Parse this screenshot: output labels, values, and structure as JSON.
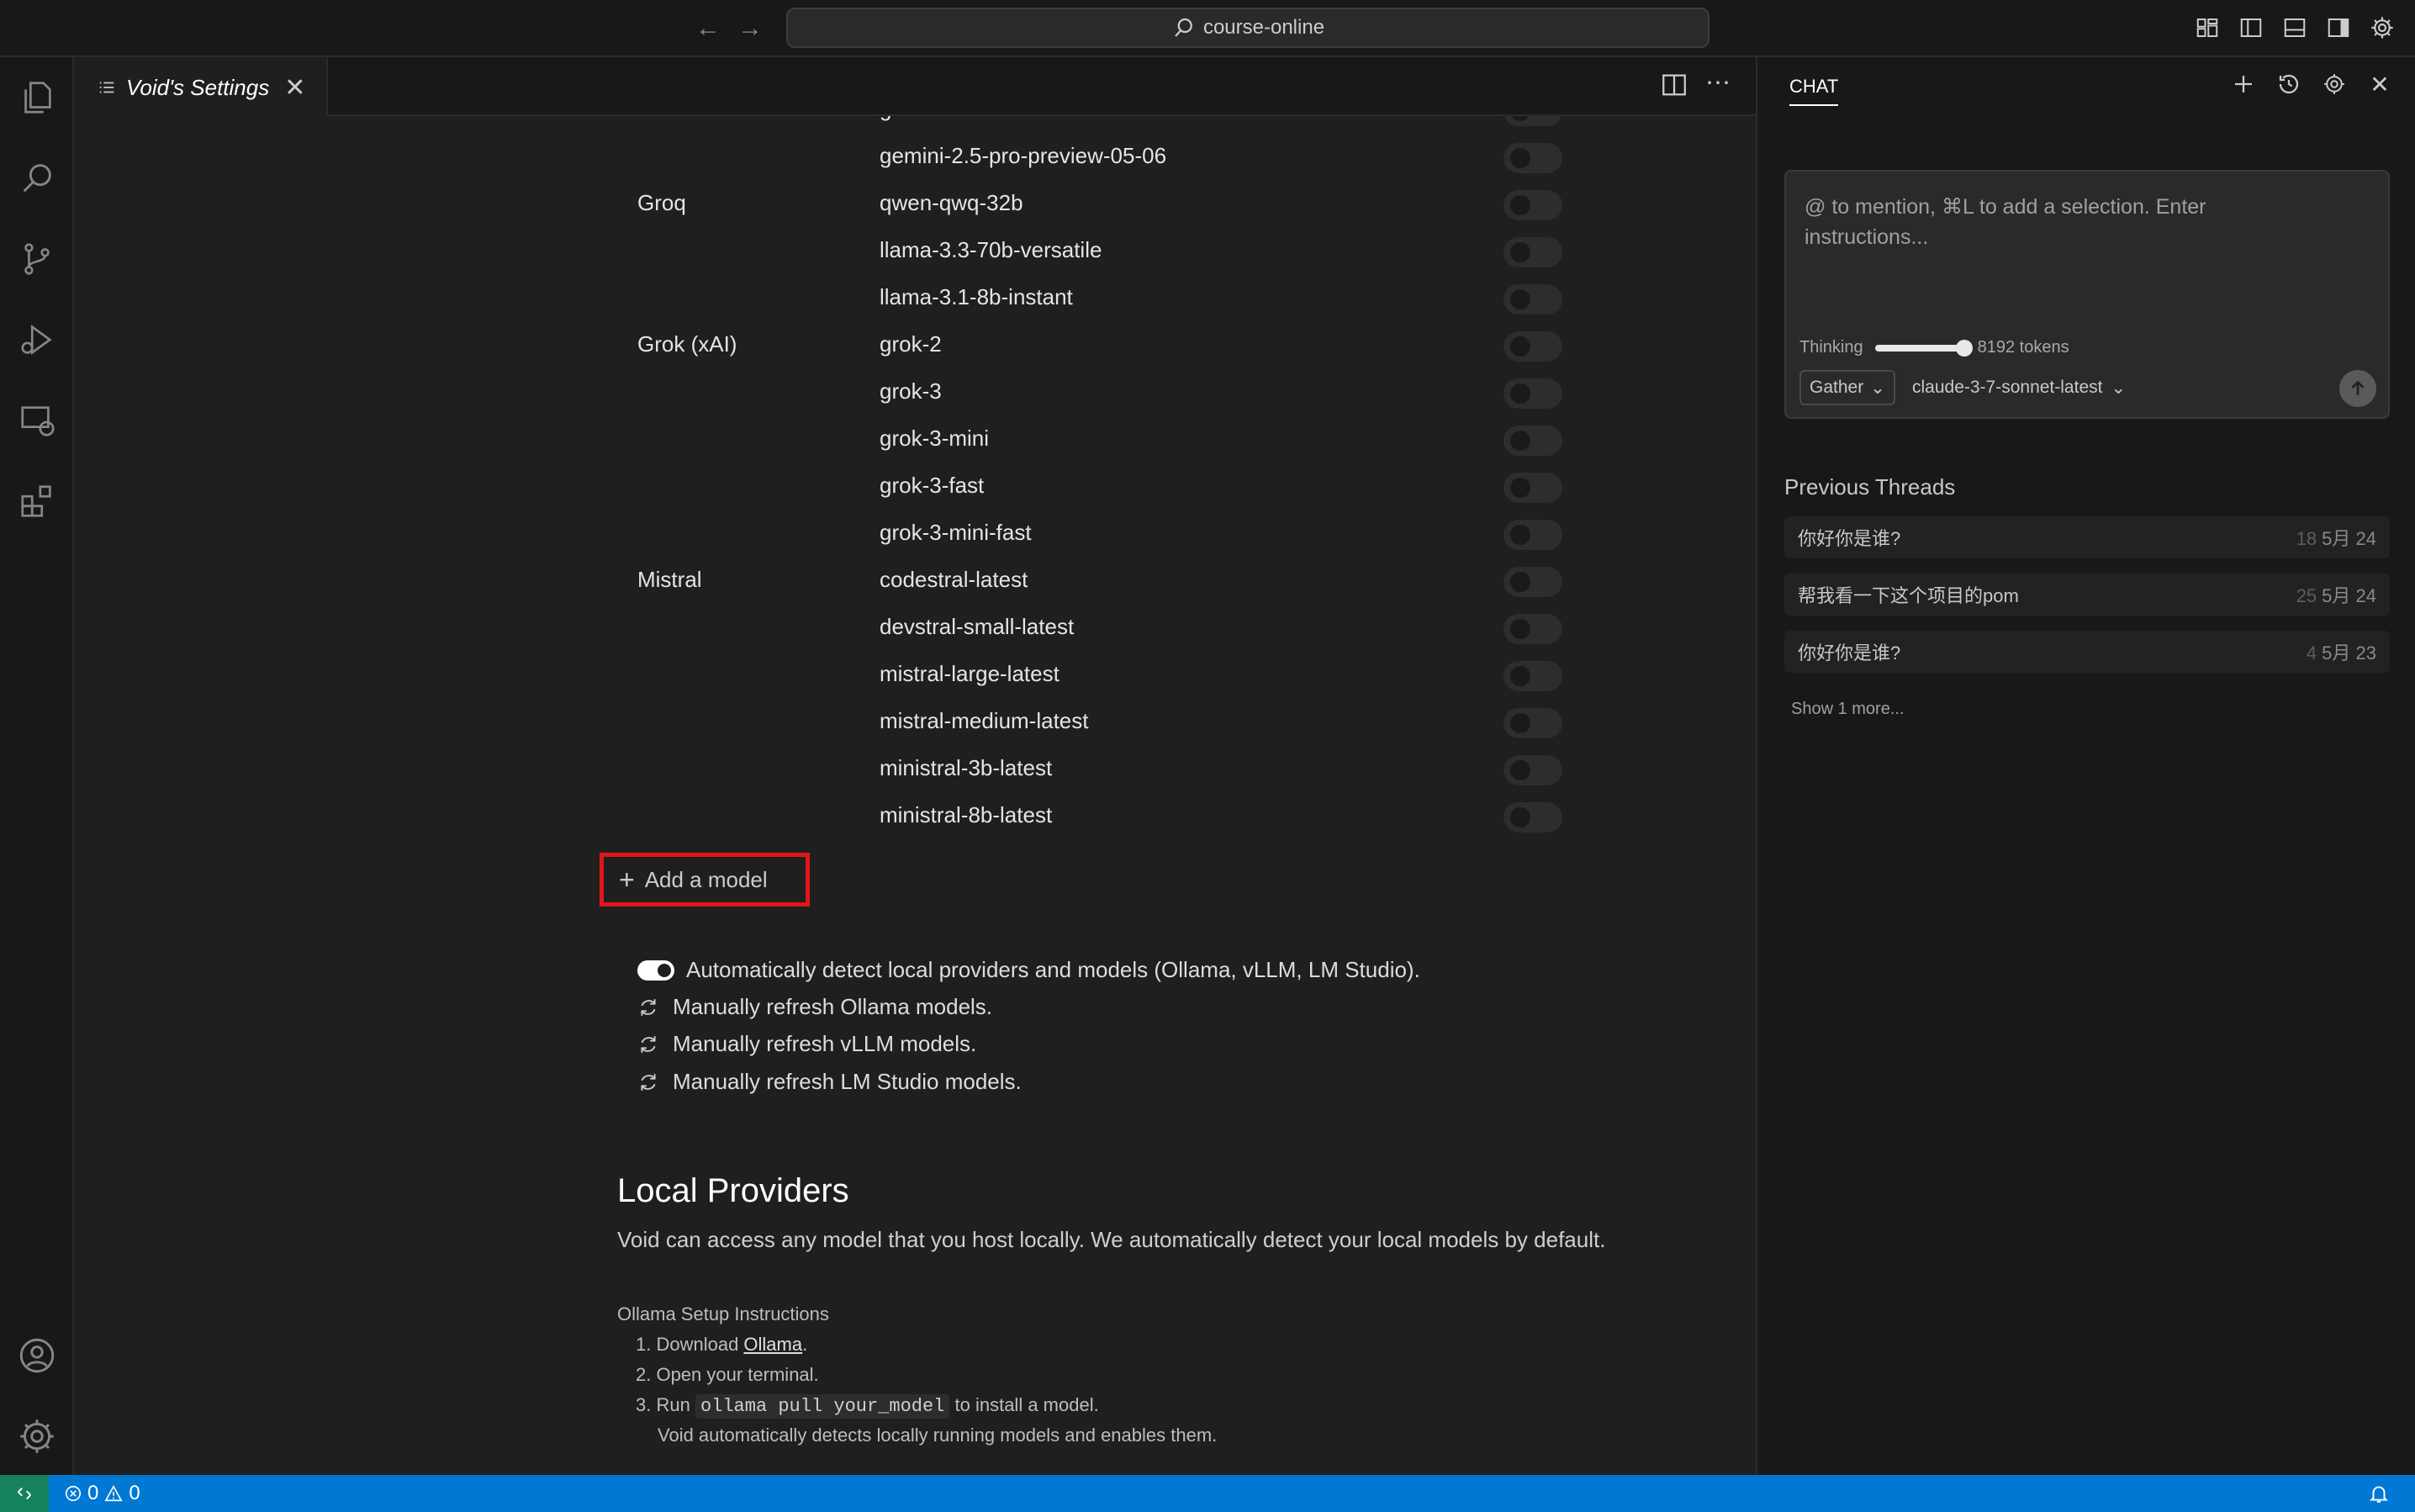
{
  "titlebar": {
    "search_text": "course-online"
  },
  "editor": {
    "tab_title": "Void's Settings",
    "rows": [
      {
        "provider": "",
        "model": "g"
      },
      {
        "provider": "",
        "model": "gemini-2.5-pro-preview-05-06"
      },
      {
        "provider": "Groq",
        "model": "qwen-qwq-32b"
      },
      {
        "provider": "",
        "model": "llama-3.3-70b-versatile"
      },
      {
        "provider": "",
        "model": "llama-3.1-8b-instant"
      },
      {
        "provider": "Grok (xAI)",
        "model": "grok-2"
      },
      {
        "provider": "",
        "model": "grok-3"
      },
      {
        "provider": "",
        "model": "grok-3-mini"
      },
      {
        "provider": "",
        "model": "grok-3-fast"
      },
      {
        "provider": "",
        "model": "grok-3-mini-fast"
      },
      {
        "provider": "Mistral",
        "model": "codestral-latest"
      },
      {
        "provider": "",
        "model": "devstral-small-latest"
      },
      {
        "provider": "",
        "model": "mistral-large-latest"
      },
      {
        "provider": "",
        "model": "mistral-medium-latest"
      },
      {
        "provider": "",
        "model": "ministral-3b-latest"
      },
      {
        "provider": "",
        "model": "ministral-8b-latest"
      }
    ],
    "add_model_label": "Add a model",
    "auto_detect_label": "Automatically detect local providers and models (Ollama, vLLM, LM Studio).",
    "refresh_ollama": "Manually refresh Ollama models.",
    "refresh_vllm": "Manually refresh vLLM models.",
    "refresh_lmstudio": "Manually refresh LM Studio models.",
    "local_providers_title": "Local Providers",
    "local_providers_desc": "Void can access any model that you host locally. We automatically detect your local models by default.",
    "setup_title": "Ollama Setup Instructions",
    "setup_1_prefix": "1. Download ",
    "setup_1_link": "Ollama",
    "setup_1_suffix": ".",
    "setup_2": "2. Open your terminal.",
    "setup_3_prefix": "3. Run ",
    "setup_3_code": "ollama pull your_model",
    "setup_3_suffix": " to install a model.",
    "setup_note": "Void automatically detects locally running models and enables them."
  },
  "chat": {
    "tab_label": "CHAT",
    "placeholder": "@ to mention, ⌘L to add a selection. Enter instructions...",
    "thinking_label": "Thinking",
    "thinking_level": 1.0,
    "tokens_label": "8192 tokens",
    "mode": "Gather",
    "model": "claude-3-7-sonnet-latest",
    "previous_threads_title": "Previous Threads",
    "threads": [
      {
        "title": "你好你是谁?",
        "count": "18",
        "date": "5月 24"
      },
      {
        "title": "帮我看一下这个项目的pom",
        "count": "25",
        "date": "5月 24"
      },
      {
        "title": "你好你是谁?",
        "count": "4",
        "date": "5月 23"
      }
    ],
    "show_more": "Show 1 more..."
  },
  "statusbar": {
    "errors": "0",
    "warnings": "0"
  },
  "colors": {
    "accent": "#0078d4",
    "highlight_box": "#e0161b",
    "remote": "#16825d"
  }
}
